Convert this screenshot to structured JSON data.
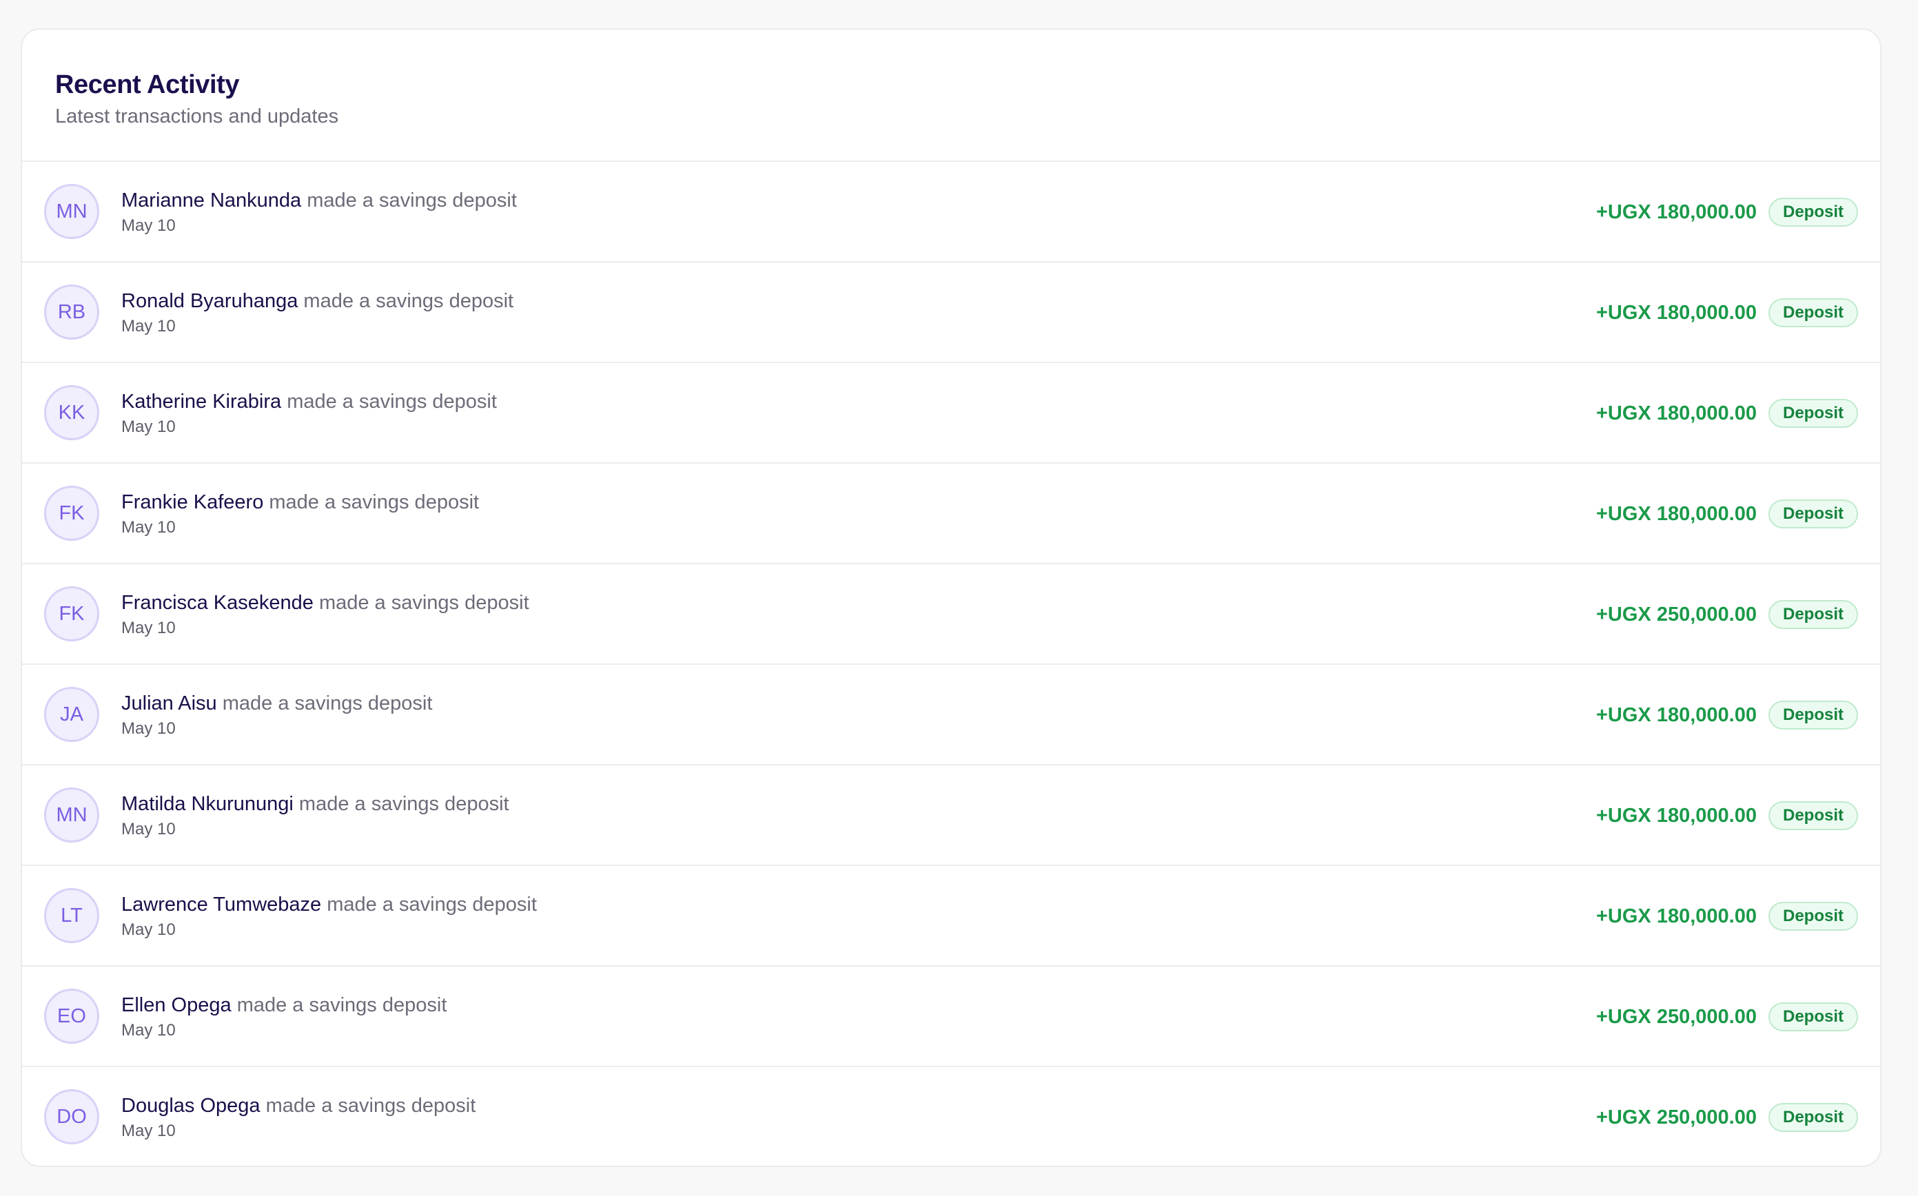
{
  "panel": {
    "title": "Recent Activity",
    "subtitle": "Latest transactions and updates"
  },
  "activities": [
    {
      "initials": "MN",
      "name": "Marianne Nankunda",
      "action": "made a savings deposit",
      "date": "May 10",
      "amount": "+UGX 180,000.00",
      "badge": "Deposit"
    },
    {
      "initials": "RB",
      "name": "Ronald Byaruhanga",
      "action": "made a savings deposit",
      "date": "May 10",
      "amount": "+UGX 180,000.00",
      "badge": "Deposit"
    },
    {
      "initials": "KK",
      "name": "Katherine Kirabira",
      "action": "made a savings deposit",
      "date": "May 10",
      "amount": "+UGX 180,000.00",
      "badge": "Deposit"
    },
    {
      "initials": "FK",
      "name": "Frankie Kafeero",
      "action": "made a savings deposit",
      "date": "May 10",
      "amount": "+UGX 180,000.00",
      "badge": "Deposit"
    },
    {
      "initials": "FK",
      "name": "Francisca Kasekende",
      "action": "made a savings deposit",
      "date": "May 10",
      "amount": "+UGX 250,000.00",
      "badge": "Deposit"
    },
    {
      "initials": "JA",
      "name": "Julian Aisu",
      "action": "made a savings deposit",
      "date": "May 10",
      "amount": "+UGX 180,000.00",
      "badge": "Deposit"
    },
    {
      "initials": "MN",
      "name": "Matilda Nkurunungi",
      "action": "made a savings deposit",
      "date": "May 10",
      "amount": "+UGX 180,000.00",
      "badge": "Deposit"
    },
    {
      "initials": "LT",
      "name": "Lawrence Tumwebaze",
      "action": "made a savings deposit",
      "date": "May 10",
      "amount": "+UGX 180,000.00",
      "badge": "Deposit"
    },
    {
      "initials": "EO",
      "name": "Ellen Opega",
      "action": "made a savings deposit",
      "date": "May 10",
      "amount": "+UGX 250,000.00",
      "badge": "Deposit"
    },
    {
      "initials": "DO",
      "name": "Douglas Opega",
      "action": "made a savings deposit",
      "date": "May 10",
      "amount": "+UGX 250,000.00",
      "badge": "Deposit"
    }
  ],
  "colors": {
    "title": "#1d0f4e",
    "amount_positive": "#1a9a49",
    "badge_bg": "#ecfbf1",
    "avatar_text": "#7b5ee2"
  }
}
